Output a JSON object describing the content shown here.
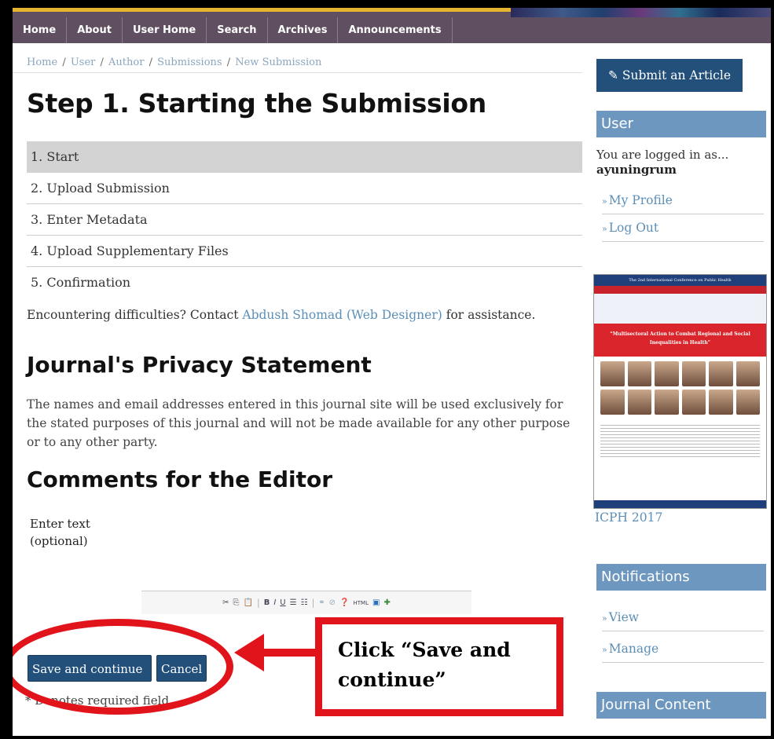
{
  "nav": {
    "items": [
      "Home",
      "About",
      "User Home",
      "Search",
      "Archives",
      "Announcements"
    ]
  },
  "breadcrumb": {
    "items": [
      "Home",
      "User",
      "Author",
      "Submissions",
      "New Submission"
    ],
    "separator": "/"
  },
  "main": {
    "title": "Step 1. Starting the Submission",
    "steps": [
      "1. Start",
      "2. Upload Submission",
      "3. Enter Metadata",
      "4. Upload Supplementary Files",
      "5. Confirmation"
    ],
    "help_prefix": "Encountering difficulties? Contact ",
    "help_contact": "Abdush Shomad (Web Designer)",
    "help_suffix": " for assistance.",
    "privacy_title": "Journal's Privacy Statement",
    "privacy_text": "The names and email addresses entered in this journal site will be used exclusively for the stated purposes of this journal and will not be made available for any other purpose or to any other party.",
    "comments_title": "Comments for the Editor",
    "enter_text_line1": "Enter text",
    "enter_text_line2": "(optional)",
    "toolbar_icons": [
      "cut-icon",
      "copy-icon",
      "paste-icon",
      "bold-icon",
      "italic-icon",
      "underline-icon",
      "bullet-list-icon",
      "numbered-list-icon",
      "link-icon",
      "unlink-icon",
      "help-icon",
      "html-icon",
      "fullscreen-icon",
      "image-icon"
    ],
    "save_label": "Save and continue",
    "cancel_label": "Cancel",
    "required_note": "* Denotes required field"
  },
  "annotation": {
    "line1": "Click “Save and",
    "line2": "continue”",
    "color": "#e1141c"
  },
  "sidebar": {
    "submit_label": "Submit an Article",
    "user_heading": "User",
    "logged_in_as": "You are logged in as...",
    "username": "ayuningrum",
    "my_profile": "My Profile",
    "log_out": "Log Out",
    "poster_heading": "The 2nd International Conference on Public Health",
    "poster_theme": "“Multisectoral Action to Combat Regional and Social Inequalities in Health”",
    "poster_caption": "ICPH 2017",
    "notifications_heading": "Notifications",
    "view": "View",
    "manage": "Manage",
    "journal_content_heading": "Journal Content"
  },
  "colors": {
    "nav_bg": "#5f4f61",
    "nav_accent": "#e7b630",
    "primary_button": "#22507a",
    "sidebar_heading": "#6d97bf",
    "link": "#5b8fb8",
    "active_step": "#d3d3d3"
  }
}
